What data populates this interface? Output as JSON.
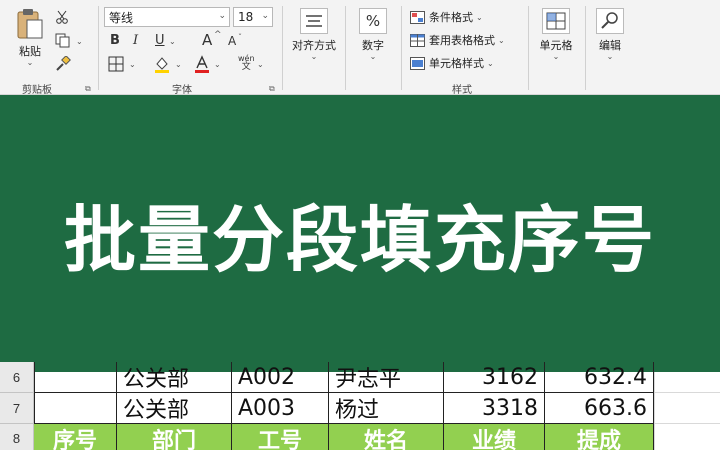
{
  "ribbon": {
    "clipboard": {
      "paste_label": "粘贴",
      "group_label": "剪贴板"
    },
    "font": {
      "font_name": "等线",
      "font_size": "18",
      "bold_label": "B",
      "italic_label": "I",
      "underline_label": "U",
      "grow_label": "A",
      "shrink_label": "A",
      "phonetic_top": "wén",
      "phonetic_bottom": "文",
      "group_label": "字体"
    },
    "alignment": {
      "label": "对齐方式"
    },
    "number": {
      "label": "数字",
      "symbol": "%"
    },
    "styles": {
      "conditional_label": "条件格式",
      "table_label": "套用表格格式",
      "cell_styles_label": "单元格样式",
      "group_label": "样式"
    },
    "cells": {
      "label": "单元格"
    },
    "editing": {
      "label": "编辑"
    }
  },
  "banner": {
    "title": "批量分段填充序号"
  },
  "sheet": {
    "rows": [
      {
        "header": "6",
        "cells": [
          "",
          "公关部",
          "A002",
          "尹志平",
          "3162",
          "632.4"
        ]
      },
      {
        "header": "7",
        "cells": [
          "",
          "公关部",
          "A003",
          "杨过",
          "3318",
          "663.6"
        ]
      },
      {
        "header": "8",
        "cells": [
          "序号",
          "部门",
          "工号",
          "姓名",
          "业绩",
          "提成"
        ]
      }
    ]
  },
  "colors": {
    "banner_bg": "#1e6b42",
    "header_row_bg": "#92d050",
    "font_color_swatch": "#e02020",
    "fill_color_swatch": "#ffd200"
  },
  "icons": {
    "paste": "clipboard-paste-icon",
    "cut": "scissors-icon",
    "copy": "copy-icon",
    "format_painter": "paintbrush-icon",
    "borders": "border-grid-icon",
    "fill": "paint-bucket-icon",
    "font_color": "font-color-icon",
    "align": "align-lines-icon",
    "cells": "table-cells-icon",
    "search": "magnifier-icon"
  }
}
